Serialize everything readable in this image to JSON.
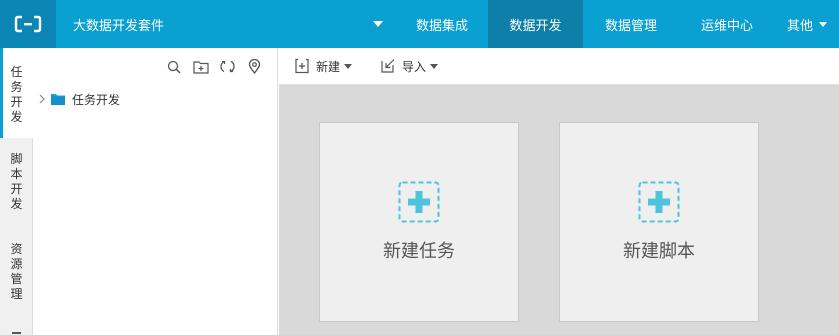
{
  "app": {
    "title": "大数据开发套件"
  },
  "nav": {
    "items": [
      {
        "label": "数据集成"
      },
      {
        "label": "数据开发"
      },
      {
        "label": "数据管理"
      },
      {
        "label": "运维中心"
      },
      {
        "label": "其他"
      }
    ]
  },
  "side_tabs": {
    "items": [
      {
        "chars": [
          "任",
          "务",
          "开",
          "发"
        ]
      },
      {
        "chars": [
          "脚",
          "本",
          "开",
          "发"
        ]
      },
      {
        "chars": [
          "资",
          "源",
          "管",
          "理"
        ]
      }
    ]
  },
  "tree": {
    "root_label": "任务开发"
  },
  "toolbar": {
    "new_label": "新建",
    "import_label": "导入"
  },
  "cards": {
    "new_task": "新建任务",
    "new_script": "新建脚本"
  },
  "colors": {
    "topbar": "#0aa0d2",
    "topbar_active": "#0e7fa8",
    "logo_bg": "#0b86b4",
    "accent": "#4fc3dc"
  }
}
